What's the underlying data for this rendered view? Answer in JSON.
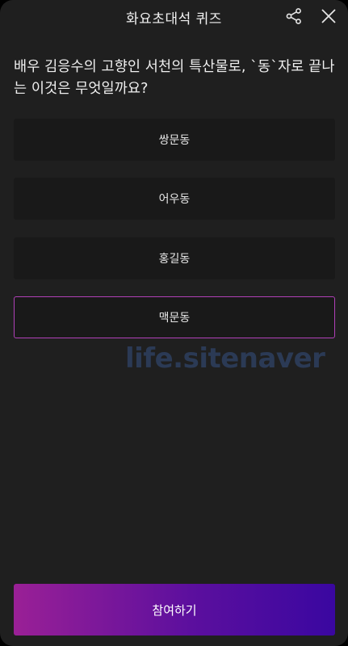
{
  "header": {
    "title": "화요초대석 퀴즈",
    "share_icon": "share-icon",
    "close_icon": "close-icon"
  },
  "question": "배우 김응수의 고향인 서천의 특산물로, `동`자로 끝나는 이것은 무엇일까요?",
  "options": [
    {
      "label": "쌍문동",
      "selected": false
    },
    {
      "label": "어우동",
      "selected": false
    },
    {
      "label": "홍길동",
      "selected": false
    },
    {
      "label": "맥문동",
      "selected": true
    }
  ],
  "watermark": "life.sitenaver",
  "submit_label": "참여하기",
  "colors": {
    "background": "#1f1f1f",
    "option_bg": "#191919",
    "selected_border": "#b040b8",
    "button_gradient_start": "#9a2096",
    "button_gradient_end": "#3a07a0",
    "watermark": "#2b3a55"
  }
}
